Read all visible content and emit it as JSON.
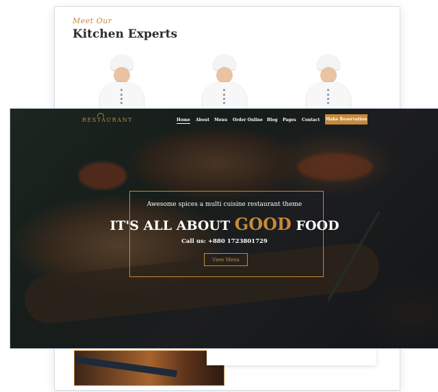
{
  "experts": {
    "kicker": "Meet Our",
    "title": "Kitchen Experts",
    "chefs": [
      "chef-1",
      "chef-2",
      "chef-3"
    ]
  },
  "nav": {
    "logo": "RESTAURANT",
    "items": [
      "Home",
      "About",
      "Menu",
      "Order Online",
      "Blog",
      "Pages",
      "Contact"
    ],
    "active": "Home",
    "cta": "Make Reservation"
  },
  "hero": {
    "tagline": "Awesome spices a multi cuisine restaurant theme",
    "headline_pre": "IT'S ALL ABOUT ",
    "headline_accent": "GOOD",
    "headline_post": " FOOD",
    "phone": "Call us: +880 1723801729",
    "button": "View Menu"
  },
  "colors": {
    "accent": "#c7893a",
    "text_dark": "#2b2b2b",
    "white": "#ffffff"
  }
}
